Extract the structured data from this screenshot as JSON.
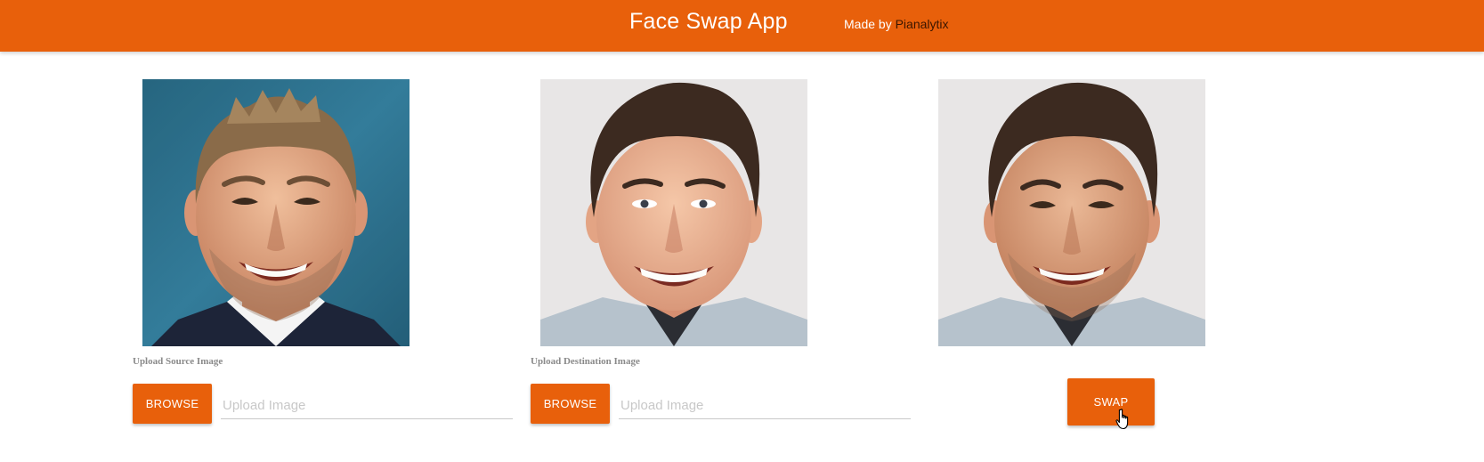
{
  "header": {
    "title": "Face Swap App",
    "made_by_prefix": "Made by ",
    "made_by_brand": "Pianalytix",
    "bg_color": "#e8600b"
  },
  "source": {
    "label": "Upload Source Image",
    "browse_label": "BROWSE",
    "placeholder": "Upload Image",
    "value": ""
  },
  "destination": {
    "label": "Upload Destination Image",
    "browse_label": "BROWSE",
    "placeholder": "Upload Image",
    "value": ""
  },
  "result": {
    "swap_label": "SWAP"
  },
  "colors": {
    "accent": "#e8600b",
    "label_gray": "#8a8a8a",
    "placeholder_gray": "#c8c8c8"
  },
  "icons": {
    "pointer": "hand-pointer-cursor-icon"
  }
}
